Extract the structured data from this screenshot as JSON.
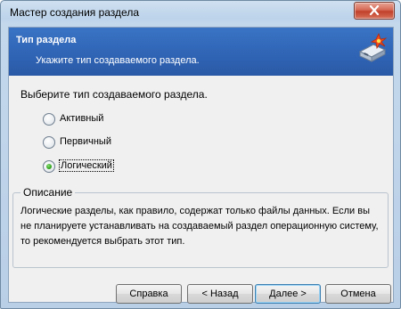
{
  "window": {
    "title": "Мастер создания раздела"
  },
  "banner": {
    "title": "Тип раздела",
    "subtitle": "Укажите тип создаваемого раздела.",
    "icon": "disk-wizard-icon"
  },
  "main": {
    "prompt": "Выберите тип создаваемого раздела.",
    "options": [
      {
        "label": "Активный",
        "checked": false
      },
      {
        "label": "Первичный",
        "checked": false
      },
      {
        "label": "Логический",
        "checked": true
      }
    ]
  },
  "description": {
    "legend": "Описание",
    "text": "Логические разделы, как правило, содержат только файлы данных. Если вы не планируете устанавливать на создаваемый раздел операционную систему, то рекомендуется выбрать этот тип."
  },
  "buttons": {
    "help": "Справка",
    "back": "< Назад",
    "next": "Далее >",
    "cancel": "Отмена"
  },
  "colors": {
    "banner": "#2f63b4",
    "close_button": "#c0412a",
    "radio_checked": "#2fa41c"
  }
}
